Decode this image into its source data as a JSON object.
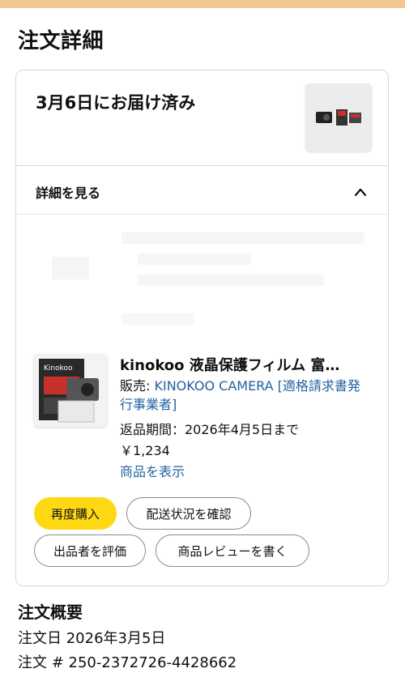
{
  "page": {
    "title": "注文詳細"
  },
  "shipment": {
    "status": "3月6日にお届け済み",
    "details_toggle": "詳細を見る"
  },
  "item": {
    "title": "kinokoo 液晶保護フィルム 富…",
    "seller_prefix": "販売: ",
    "seller_name": "KINOKOO CAMERA [適格請求書発行事業者]",
    "return_window": "返品期間：2026年4月5日まで",
    "price": "￥1,234",
    "view_item": "商品を表示",
    "thumb_brand": "Kinokoo"
  },
  "actions": {
    "buy_again": "再度購入",
    "track_package": "配送状況を確認",
    "rate_seller": "出品者を評価",
    "write_review": "商品レビューを書く"
  },
  "summary": {
    "title": "注文概要",
    "order_date": "注文日 2026年3月5日",
    "order_number": "注文 # 250-2372726-4428662"
  },
  "colors": {
    "accent_button": "#ffd814",
    "link": "#2162a1",
    "top_bar": "#f0c892"
  },
  "icons": {
    "details_toggle": "chevron-up-icon"
  }
}
